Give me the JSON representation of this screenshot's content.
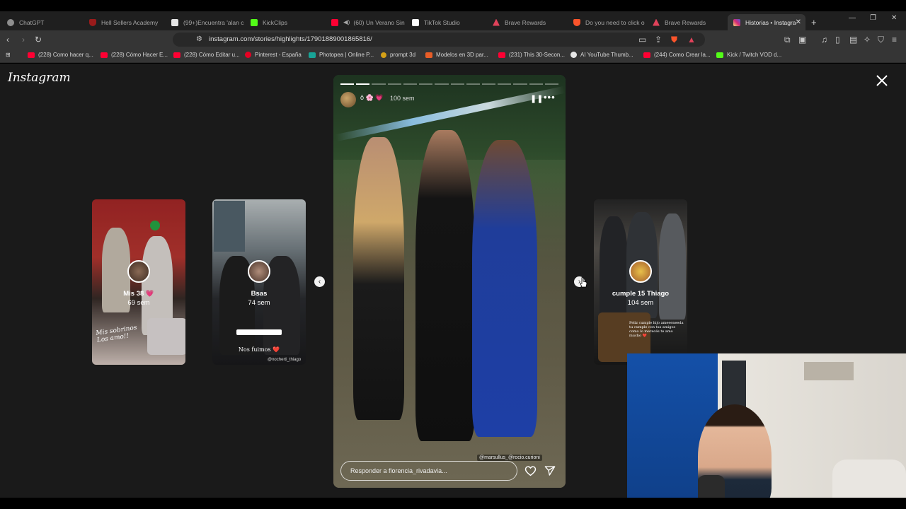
{
  "tabs": [
    {
      "label": "ChatGPT",
      "color": "#8e8e8e"
    },
    {
      "label": "Hell Sellers Academy",
      "color": "#9a1b1b"
    },
    {
      "label": "(99+)Encuentra 'alan c",
      "color": "#e6e6e6"
    },
    {
      "label": "KickClips",
      "color": "#53fc18"
    },
    {
      "label": "(60) Un Verano Sin",
      "color": "#ff0033"
    },
    {
      "label": "TikTok Studio",
      "color": "#ffffff"
    },
    {
      "label": "Brave Rewards",
      "color": "#e0425a"
    },
    {
      "label": "Do you need to click o",
      "color": "#fb542b"
    },
    {
      "label": "Brave Rewards",
      "color": "#e0425a"
    },
    {
      "label": "Historias • Instagra",
      "color": "#d6249f"
    }
  ],
  "new_tab_glyph": "+",
  "address": {
    "url": "instagram.com/stories/highlights/17901889001865816/"
  },
  "bookmarks": [
    {
      "label": "(228) Como hacer q...",
      "color": "#ff0033"
    },
    {
      "label": "(228) Cómo Hacer E...",
      "color": "#ff0033"
    },
    {
      "label": "(228) Cómo Editar u...",
      "color": "#ff0033"
    },
    {
      "label": "Pinterest - España",
      "color": "#e60023"
    },
    {
      "label": "Photopea | Online P...",
      "color": "#18a497"
    },
    {
      "label": "prompt 3d",
      "color": "#d4a017"
    },
    {
      "label": "Modelos en 3D par...",
      "color": "#e85d27"
    },
    {
      "label": "(231) This 30-Secon...",
      "color": "#ff0033"
    },
    {
      "label": "AI YouTube Thumb...",
      "color": "#e6e6e6"
    },
    {
      "label": "(244) Como Crear la...",
      "color": "#ff0033"
    },
    {
      "label": "Kick / Twitch VOD d...",
      "color": "#53fc18"
    }
  ],
  "page": {
    "logo": "Instagram"
  },
  "story": {
    "time": "100 sem",
    "emojis": "ô 🌸 💗",
    "progress_total": 14,
    "progress_done": 2,
    "mention": "@marsullus_@rocio.curioni",
    "reply_placeholder": "Responder a florencia_rivadavia..."
  },
  "previews": [
    {
      "title": "Mis 38 💗",
      "weeks": "69 sem",
      "caption": "Mis sobrinos Los amo!!"
    },
    {
      "title": "Bsas",
      "weeks": "74 sem",
      "caption": "Nos fuimos ❤️",
      "caption2": "@nocherti_thiago"
    },
    {
      "title": "cumple 15 Thiago",
      "weeks": "104 sem",
      "caption": "Feliz cumple hijo ameeeneeda tu cumple con tus amigos como lo merecés te amo mucho ❤️"
    }
  ]
}
